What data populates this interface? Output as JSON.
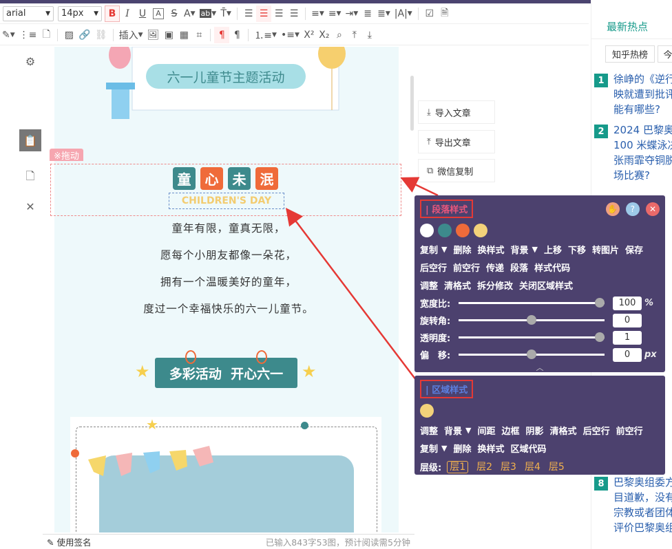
{
  "toolbar": {
    "font_family": "arial",
    "font_size": "14px",
    "bold": "B",
    "italic": "I",
    "underline": "U",
    "box_a": "A",
    "strike": "S",
    "font_color": "A",
    "bg_label": "ab",
    "insert_label": "插入",
    "superscript": "X²",
    "subscript": "X₂",
    "pilcrow": "¶"
  },
  "left_tools": [
    "settings-icon",
    "clipboard-icon",
    "document-icon",
    "close-icon"
  ],
  "drag_label": "※拖动",
  "title_banner": "六一儿童节主题活动",
  "header_tiles": [
    {
      "text": "童",
      "color": "#3d8a8c"
    },
    {
      "text": "心",
      "color": "#ef6b3a"
    },
    {
      "text": "未",
      "color": "#3d8a8c"
    },
    {
      "text": "泯",
      "color": "#ef6b3a"
    }
  ],
  "english_title": "CHILDREN'S DAY",
  "poem": [
    "童年有限，童真无限，",
    "愿每个小朋友都像一朵花，",
    "拥有一个温暖美好的童年，",
    "度过一个幸福快乐的六一儿童节。"
  ],
  "activity_banner": "多彩活动  开心六一",
  "status": {
    "signature": "使用签名",
    "count": "已输入843字53图，预计阅读需5分钟"
  },
  "side_buttons": [
    {
      "label": "导入文章",
      "icon": "import-icon"
    },
    {
      "label": "导出文章",
      "icon": "export-icon"
    },
    {
      "label": "微信复制",
      "icon": "copy-icon"
    }
  ],
  "para_panel": {
    "title": "| 段落样式",
    "swatches": [
      "#ffffff",
      "#3d8a8c",
      "#ef6b3a",
      "#f3d27a"
    ],
    "actions_row1": [
      "复制",
      "▼",
      "删除",
      "换样式",
      "背景",
      "▼",
      "上移",
      "下移",
      "转图片",
      "保存"
    ],
    "actions_row2": [
      "后空行",
      "前空行",
      "传递",
      "段落",
      "样式代码"
    ],
    "actions_row3": [
      "调整",
      "清格式",
      "拆分修改",
      "关闭区域样式"
    ],
    "sliders": [
      {
        "label": "宽度比:",
        "value": "100",
        "unit": "%",
        "level": 1.0
      },
      {
        "label": "旋转角:",
        "value": "0",
        "unit": "",
        "level": 0.5
      },
      {
        "label": "透明度:",
        "value": "1",
        "unit": "",
        "level": 1.0
      },
      {
        "label": "偏　移:",
        "value": "0",
        "unit": "px",
        "level": 0.5
      }
    ]
  },
  "area_panel": {
    "title": "| 区域样式",
    "swatch": "#f3d27a",
    "actions_row1": [
      "调整",
      "背景",
      "▼",
      "间距",
      "边框",
      "阴影",
      "清格式",
      "后空行",
      "前空行"
    ],
    "actions_row2": [
      "复制",
      "▼",
      "删除",
      "换样式",
      "区域代码"
    ],
    "layer_label": "层级:",
    "layers": [
      "层1",
      "层2",
      "层3",
      "层4",
      "层5"
    ]
  },
  "news": {
    "header": "最新热点",
    "tabs": [
      "知乎热榜",
      "今"
    ],
    "items": [
      {
        "num": "1",
        "text": "徐峥的《逆行\n映就遭到批评\n能有哪些?"
      },
      {
        "num": "2",
        "text": "2024 巴黎奥\n100 米蝶泳决\n张雨霏夺铜脱\n场比赛?"
      },
      {
        "num": "8",
        "text": "巴黎奥组委方\n目道歉，没有\n宗教或者团体\n评价巴黎奥组"
      }
    ]
  }
}
